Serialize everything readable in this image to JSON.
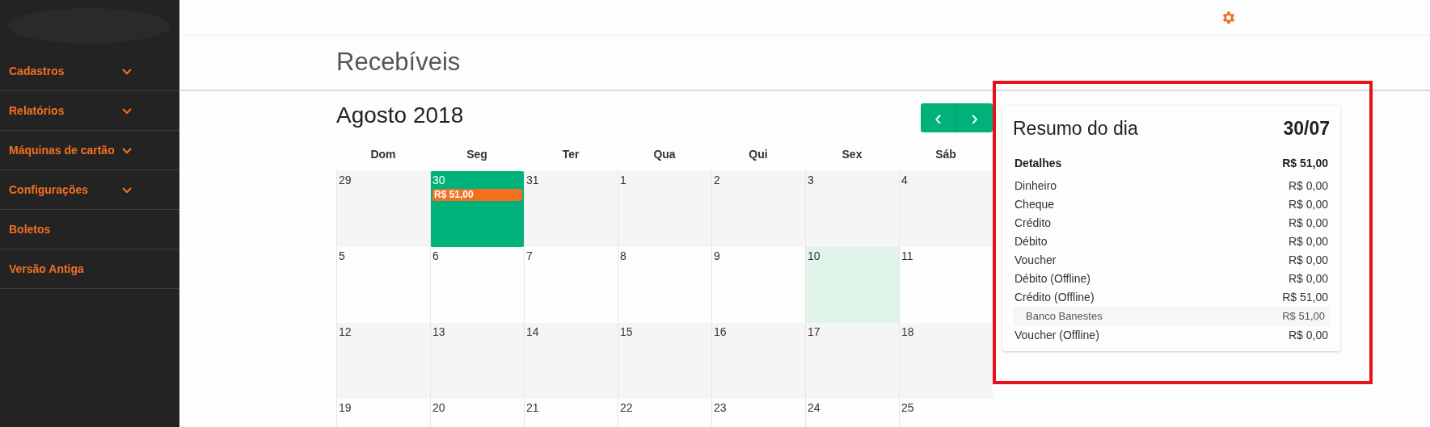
{
  "sidebar": {
    "items": [
      {
        "label": "Cadastros",
        "expandable": true
      },
      {
        "label": "Relatórios",
        "expandable": true
      },
      {
        "label": "Máquinas de cartão",
        "expandable": true
      },
      {
        "label": "Configurações",
        "expandable": true
      },
      {
        "label": "Boletos",
        "expandable": false
      },
      {
        "label": "Versão Antiga",
        "expandable": false
      }
    ]
  },
  "page_title": "Recebíveis",
  "calendar": {
    "month": "Agosto 2018",
    "prev_button": "‹",
    "next_button": "›",
    "weekdays": [
      "Dom",
      "Seg",
      "Ter",
      "Qua",
      "Qui",
      "Sex",
      "Sáb"
    ],
    "weeks": [
      {
        "days": [
          {
            "day": "29",
            "selected": false,
            "today": false
          },
          {
            "day": "30",
            "selected": true,
            "today": false,
            "entry": "R$ 51,00"
          },
          {
            "day": "31",
            "selected": false,
            "today": false
          },
          {
            "day": "1",
            "selected": false,
            "today": false
          },
          {
            "day": "2",
            "selected": false,
            "today": false
          },
          {
            "day": "3",
            "selected": false,
            "today": false
          },
          {
            "day": "4",
            "selected": false,
            "today": false
          }
        ]
      },
      {
        "days": [
          {
            "day": "5",
            "selected": false,
            "today": false
          },
          {
            "day": "6",
            "selected": false,
            "today": false
          },
          {
            "day": "7",
            "selected": false,
            "today": false
          },
          {
            "day": "8",
            "selected": false,
            "today": false
          },
          {
            "day": "9",
            "selected": false,
            "today": false
          },
          {
            "day": "10",
            "selected": false,
            "today": true
          },
          {
            "day": "11",
            "selected": false,
            "today": false
          }
        ]
      },
      {
        "days": [
          {
            "day": "12",
            "selected": false,
            "today": false
          },
          {
            "day": "13",
            "selected": false,
            "today": false
          },
          {
            "day": "14",
            "selected": false,
            "today": false
          },
          {
            "day": "15",
            "selected": false,
            "today": false
          },
          {
            "day": "16",
            "selected": false,
            "today": false
          },
          {
            "day": "17",
            "selected": false,
            "today": false
          },
          {
            "day": "18",
            "selected": false,
            "today": false
          }
        ]
      },
      {
        "days": [
          {
            "day": "19",
            "selected": false,
            "today": false
          },
          {
            "day": "20",
            "selected": false,
            "today": false
          },
          {
            "day": "21",
            "selected": false,
            "today": false
          },
          {
            "day": "22",
            "selected": false,
            "today": false
          },
          {
            "day": "23",
            "selected": false,
            "today": false
          },
          {
            "day": "24",
            "selected": false,
            "today": false
          },
          {
            "day": "25",
            "selected": false,
            "today": false
          }
        ]
      }
    ]
  },
  "summary": {
    "title": "Resumo do dia",
    "date": "30/07",
    "header": {
      "label": "Detalhes",
      "amount": "R$ 51,00"
    },
    "rows": [
      {
        "kind": "item",
        "label": "Dinheiro",
        "amount": "R$ 0,00"
      },
      {
        "kind": "item",
        "label": "Cheque",
        "amount": "R$ 0,00"
      },
      {
        "kind": "item",
        "label": "Crédito",
        "amount": "R$ 0,00"
      },
      {
        "kind": "item",
        "label": "Débito",
        "amount": "R$ 0,00"
      },
      {
        "kind": "item",
        "label": "Voucher",
        "amount": "R$ 0,00"
      },
      {
        "kind": "item",
        "label": "Débito (Offline)",
        "amount": "R$ 0,00"
      },
      {
        "kind": "item",
        "label": "Crédito (Offline)",
        "amount": "R$ 51,00"
      },
      {
        "kind": "sub",
        "label": "Banco Banestes",
        "amount": "R$ 51,00"
      },
      {
        "kind": "item",
        "label": "Voucher (Offline)",
        "amount": "R$ 0,00"
      }
    ]
  }
}
